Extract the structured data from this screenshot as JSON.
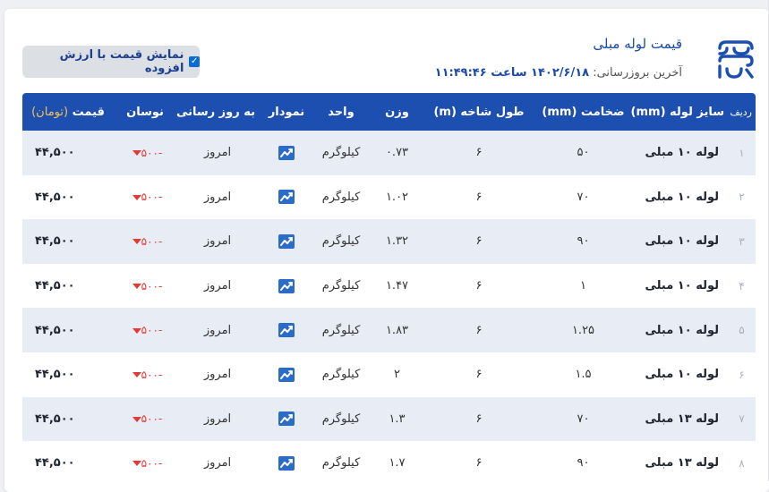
{
  "header": {
    "title": "قیمت لوله مبلی",
    "updated_label": "آخرین بروزرسانی:",
    "updated_value": "۱۴۰۲/۶/۱۸ ساعت ۱۱:۴۹:۴۶",
    "vat_toggle_label": "نمایش قیمت با ارزش افزوده",
    "vat_checked": true
  },
  "columns": {
    "row": "ردیف",
    "size": "سایز لوله (mm)",
    "thickness": "ضخامت (mm)",
    "branch_length": "طول شاخه (m)",
    "weight": "وزن",
    "unit": "واحد",
    "chart": "نمودار",
    "updated": "به روز رسانی",
    "change": "نوسان",
    "price": "قیمت",
    "price_unit": "(تومان)"
  },
  "rows": [
    {
      "num": "۱",
      "size": "لوله ۱۰ مبلی",
      "thickness": "۵۰",
      "length": "۶",
      "weight": "۰.۷۳",
      "unit": "کیلوگرم",
      "updated": "امروز",
      "change": "-۵۰۰",
      "price": "۴۴,۵۰۰"
    },
    {
      "num": "۲",
      "size": "لوله ۱۰ مبلی",
      "thickness": "۷۰",
      "length": "۶",
      "weight": "۱.۰۲",
      "unit": "کیلوگرم",
      "updated": "امروز",
      "change": "-۵۰۰",
      "price": "۴۴,۵۰۰"
    },
    {
      "num": "۳",
      "size": "لوله ۱۰ مبلی",
      "thickness": "۹۰",
      "length": "۶",
      "weight": "۱.۳۲",
      "unit": "کیلوگرم",
      "updated": "امروز",
      "change": "-۵۰۰",
      "price": "۴۴,۵۰۰"
    },
    {
      "num": "۴",
      "size": "لوله ۱۰ مبلی",
      "thickness": "۱",
      "length": "۶",
      "weight": "۱.۴۷",
      "unit": "کیلوگرم",
      "updated": "امروز",
      "change": "-۵۰۰",
      "price": "۴۴,۵۰۰"
    },
    {
      "num": "۵",
      "size": "لوله ۱۰ مبلی",
      "thickness": "۱.۲۵",
      "length": "۶",
      "weight": "۱.۸۳",
      "unit": "کیلوگرم",
      "updated": "امروز",
      "change": "-۵۰۰",
      "price": "۴۴,۵۰۰"
    },
    {
      "num": "۶",
      "size": "لوله ۱۰ مبلی",
      "thickness": "۱.۵",
      "length": "۶",
      "weight": "۲",
      "unit": "کیلوگرم",
      "updated": "امروز",
      "change": "-۵۰۰",
      "price": "۴۴,۵۰۰"
    },
    {
      "num": "۷",
      "size": "لوله ۱۳ مبلی",
      "thickness": "۷۰",
      "length": "۶",
      "weight": "۱.۳",
      "unit": "کیلوگرم",
      "updated": "امروز",
      "change": "-۵۰۰",
      "price": "۴۴,۵۰۰"
    },
    {
      "num": "۸",
      "size": "لوله ۱۳ مبلی",
      "thickness": "۹۰",
      "length": "۶",
      "weight": "۱.۷",
      "unit": "کیلوگرم",
      "updated": "امروز",
      "change": "-۵۰۰",
      "price": "۴۴,۵۰۰"
    }
  ],
  "icons": {
    "logo": "brand-logo-icon",
    "chart": "trend-chart-icon",
    "change": "down-triangle-icon"
  },
  "colors": {
    "accent": "#1c4fb0",
    "price_unit": "#f5c44e",
    "negative": "#e53935",
    "row_stripe": "#e8ecf5"
  }
}
